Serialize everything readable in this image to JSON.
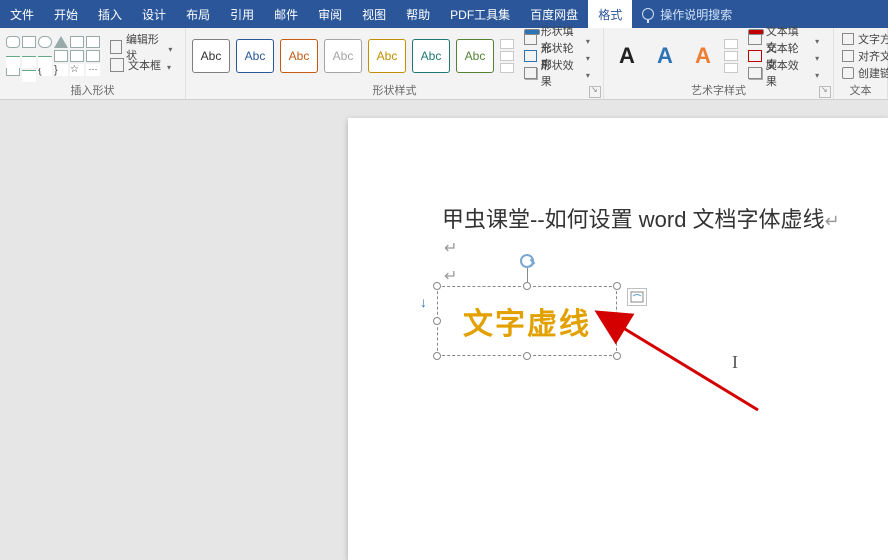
{
  "tabs": {
    "file": "文件",
    "home": "开始",
    "insert": "插入",
    "design": "设计",
    "layout": "布局",
    "references": "引用",
    "mailings": "邮件",
    "review": "审阅",
    "view": "视图",
    "help": "帮助",
    "pdf": "PDF工具集",
    "baidu": "百度网盘",
    "format": "格式",
    "tell_me": "操作说明搜索"
  },
  "ribbon": {
    "insert_shapes": {
      "edit_shape": "编辑形状",
      "text_box": "文本框",
      "group_label": "插入形状"
    },
    "shape_styles": {
      "sample": "Abc",
      "shape_fill": "形状填充",
      "shape_outline": "形状轮廓",
      "shape_effects": "形状效果",
      "group_label": "形状样式"
    },
    "wordart_styles": {
      "sample": "A",
      "text_fill": "文本填充",
      "text_outline": "文本轮廓",
      "text_effects": "文本效果",
      "group_label": "艺术字样式"
    },
    "text": {
      "text_direction": "文字方向",
      "align_text": "对齐文本",
      "create_link": "创建链接",
      "group_label": "文本"
    }
  },
  "document": {
    "title_text": "甲虫课堂--如何设置 word 文档字体虚线",
    "textbox_text": "文字虚线"
  }
}
